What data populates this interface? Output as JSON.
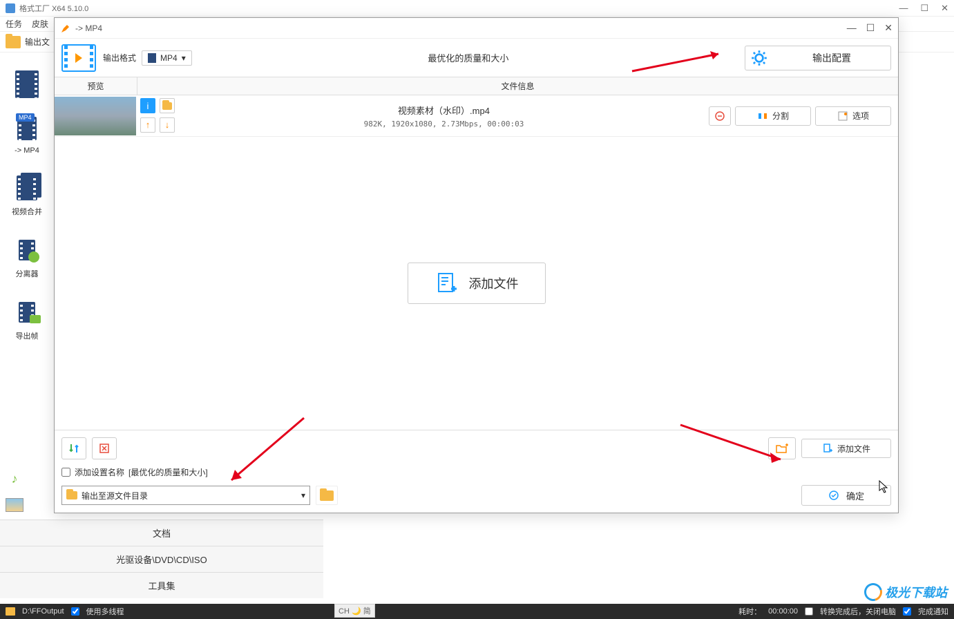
{
  "main": {
    "title": "格式工厂 X64 5.10.0",
    "menu": {
      "task": "任务",
      "skin": "皮肤"
    },
    "output_label": "输出文",
    "win": {
      "min": "—",
      "max": "☐",
      "close": "✕"
    }
  },
  "sidebar": {
    "to_mp4": "-> MP4",
    "video_merge": "视频合并",
    "separator": "分离器",
    "export_frame": "导出帧"
  },
  "categories": {
    "document": "文档",
    "optical": "光驱设备\\DVD\\CD\\ISO",
    "tools": "工具集"
  },
  "statusbar": {
    "output_path": "D:\\FFOutput",
    "multithread": "使用多线程",
    "elapsed_label": "耗时：",
    "elapsed": "00:00:00",
    "shutdown": "转换完成后，关闭电脑",
    "notify": "完成通知"
  },
  "ime": "CH 🌙 简",
  "dialog": {
    "title": "-> MP4",
    "win": {
      "min": "—",
      "max": "☐",
      "close": "✕"
    },
    "output_format_label": "输出格式",
    "format": "MP4",
    "quality": "最优化的质量和大小",
    "output_config": "输出配置",
    "headers": {
      "preview": "预览",
      "fileinfo": "文件信息"
    },
    "file": {
      "name": "视频素材（水印）.mp4",
      "info": "982K, 1920x1080, 2.73Mbps, 00:00:03",
      "split": "分割",
      "options": "选项"
    },
    "add_file": "添加文件",
    "append_settings_label": "添加设置名称",
    "append_settings_value": "[最优化的质量和大小]",
    "output_to_source": "输出至源文件目录",
    "add_file_btn": "添加文件",
    "ok": "确定"
  },
  "watermark": "极光下载站"
}
